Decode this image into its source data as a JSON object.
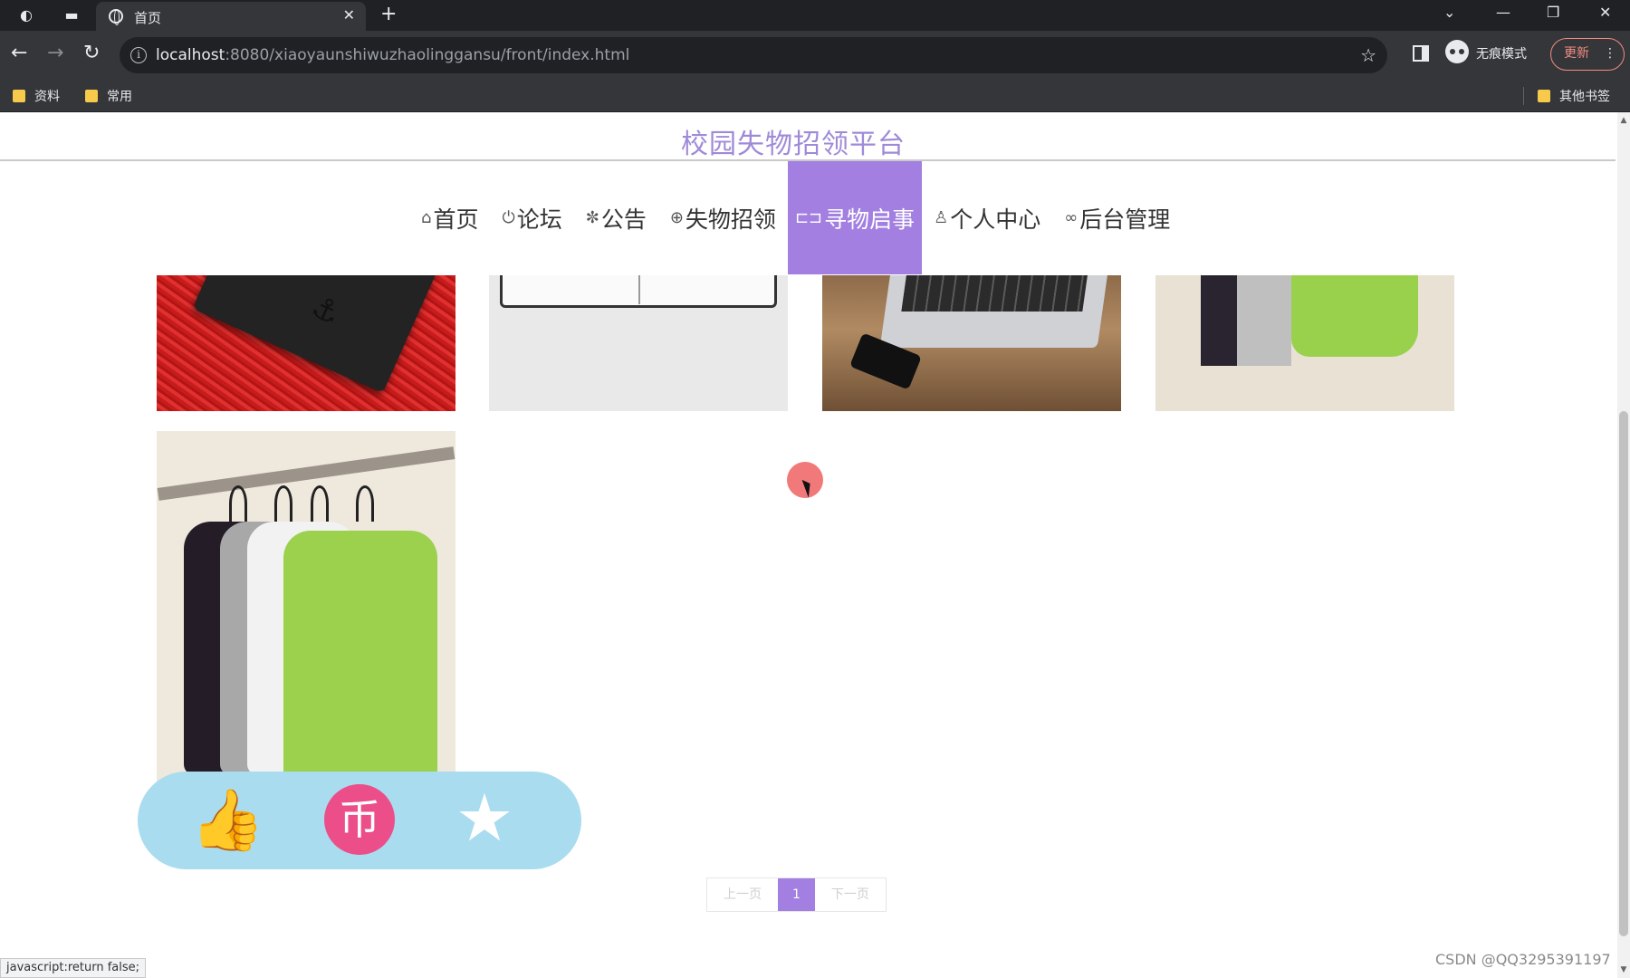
{
  "browser": {
    "tab_title": "首页",
    "url_host": "localhost",
    "url_rest": ":8080/xiaoyaunshiwuzhaolinggansu/front/index.html",
    "incognito_label": "无痕模式",
    "update_label": "更新",
    "bookmarks": [
      "资料",
      "常用"
    ],
    "other_bookmarks": "其他书签",
    "status_text": "javascript:return false;"
  },
  "site": {
    "title": "校园失物招领平台",
    "accent_color": "#a27fe0"
  },
  "nav": {
    "items": [
      {
        "icon": "home-icon",
        "label": "首页",
        "glyph": "⌂"
      },
      {
        "icon": "power-icon",
        "label": "论坛",
        "glyph": "⏻"
      },
      {
        "icon": "snowflake-icon",
        "label": "公告",
        "glyph": "✼"
      },
      {
        "icon": "gamepad-icon",
        "label": "失物招领",
        "glyph": "⊕"
      },
      {
        "icon": "reader-icon",
        "label": "寻物启事",
        "glyph": "⊏⊐",
        "active": true
      },
      {
        "icon": "user-icon",
        "label": "个人中心",
        "glyph": "♙"
      },
      {
        "icon": "link-icon",
        "label": "后台管理",
        "glyph": "∞"
      }
    ]
  },
  "gallery": {
    "items": [
      {
        "image": "wallet-on-red-carpet"
      },
      {
        "image": "open-book"
      },
      {
        "image": "laptop-and-phone"
      },
      {
        "image": "shirts-on-rack"
      },
      {
        "image": "tshirts-on-hangers"
      }
    ]
  },
  "actions": {
    "like_icon": "thumbs-up-icon",
    "coin_icon": "coin-icon",
    "coin_glyph": "币",
    "favorite_icon": "star-icon"
  },
  "pager": {
    "prev": "上一页",
    "current": "1",
    "next": "下一页"
  },
  "watermark": "CSDN @QQ3295391197"
}
